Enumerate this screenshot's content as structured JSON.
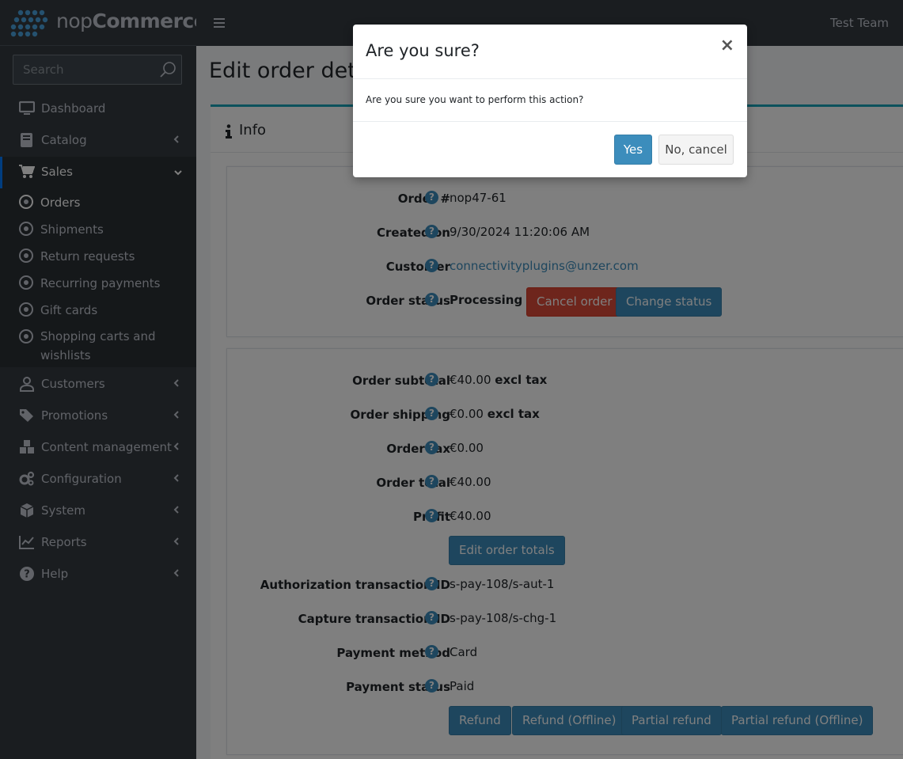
{
  "brand": {
    "name_light": "nop",
    "name_bold": "Commerce"
  },
  "search": {
    "placeholder": "Search"
  },
  "header": {
    "user": "Test Team"
  },
  "sidebar": {
    "items": [
      {
        "label": "Dashboard",
        "icon": "monitor-icon"
      },
      {
        "label": "Catalog",
        "icon": "book-icon"
      },
      {
        "label": "Sales",
        "icon": "cart-icon"
      },
      {
        "label": "Customers",
        "icon": "user-icon"
      },
      {
        "label": "Promotions",
        "icon": "tags-icon"
      },
      {
        "label": "Content management",
        "icon": "cubes-icon"
      },
      {
        "label": "Configuration",
        "icon": "gears-icon"
      },
      {
        "label": "System",
        "icon": "cube-icon"
      },
      {
        "label": "Reports",
        "icon": "chart-line-icon"
      },
      {
        "label": "Help",
        "icon": "question-circle-icon"
      }
    ],
    "sales_sub": [
      {
        "label": "Orders"
      },
      {
        "label": "Shipments"
      },
      {
        "label": "Return requests"
      },
      {
        "label": "Recurring payments"
      },
      {
        "label": "Gift cards"
      },
      {
        "label": "Shopping carts and"
      },
      {
        "label": "wishlists"
      }
    ]
  },
  "page": {
    "title": "Edit order details",
    "card_title": "Info"
  },
  "order": {
    "number_label": "Order #",
    "number": "nop47-61",
    "created_label": "Created on",
    "created": "9/30/2024 11:20:06 AM",
    "customer_label": "Customer",
    "customer": "connectivityplugins@unzer.com",
    "status_label": "Order status",
    "status": "Processing",
    "cancel_button": "Cancel order",
    "change_status_button": "Change status"
  },
  "totals": {
    "subtotal_label": "Order subtotal",
    "subtotal": "€40.00",
    "subtotal_tax": "excl tax",
    "shipping_label": "Order shipping",
    "shipping": "€0.00",
    "shipping_tax": "excl tax",
    "tax_label": "Order tax",
    "tax": "€0.00",
    "total_label": "Order total",
    "total": "€40.00",
    "profit_label": "Profit",
    "profit": "€40.00",
    "edit_totals_button": "Edit order totals",
    "auth_label": "Authorization transaction ID",
    "auth": "s-pay-108/s-aut-1",
    "capture_label": "Capture transaction ID",
    "capture": "s-pay-108/s-chg-1",
    "method_label": "Payment method",
    "method": "Card",
    "payment_status_label": "Payment status",
    "payment_status": "Paid",
    "refund_button": "Refund",
    "refund_offline_button": "Refund (Offline)",
    "partial_refund_button": "Partial refund",
    "partial_refund_offline_button": "Partial refund (Offline)"
  },
  "modal": {
    "title": "Are you sure?",
    "close": "×",
    "message": "Are you sure you want to perform this action?",
    "yes": "Yes",
    "no": "No, cancel"
  },
  "colors": {
    "sidebar": "#343a40",
    "accent": "#3c8dbc",
    "danger": "#dd4b39",
    "card_border": "#17a2b8"
  }
}
